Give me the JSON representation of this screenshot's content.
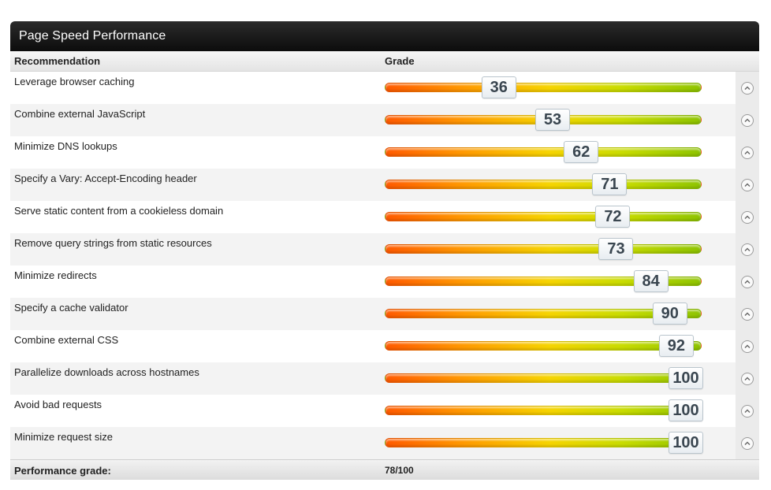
{
  "panel": {
    "title": "Page Speed Performance"
  },
  "table": {
    "col_recommendation": "Recommendation",
    "col_grade": "Grade",
    "rows": [
      {
        "label": "Leverage browser caching",
        "grade": "36"
      },
      {
        "label": "Combine external JavaScript",
        "grade": "53"
      },
      {
        "label": "Minimize DNS lookups",
        "grade": "62"
      },
      {
        "label": "Specify a Vary: Accept-Encoding header",
        "grade": "71"
      },
      {
        "label": "Serve static content from a cookieless domain",
        "grade": "72"
      },
      {
        "label": "Remove query strings from static resources",
        "grade": "73"
      },
      {
        "label": "Minimize redirects",
        "grade": "84"
      },
      {
        "label": "Specify a cache validator",
        "grade": "90"
      },
      {
        "label": "Combine external CSS",
        "grade": "92"
      },
      {
        "label": "Parallelize downloads across hostnames",
        "grade": "100"
      },
      {
        "label": "Avoid bad requests",
        "grade": "100"
      },
      {
        "label": "Minimize request size",
        "grade": "100"
      }
    ]
  },
  "footer": {
    "label": "Performance grade:",
    "value": "78/100"
  },
  "icons": {
    "row_toggle": "chevron-up-circle-icon"
  }
}
